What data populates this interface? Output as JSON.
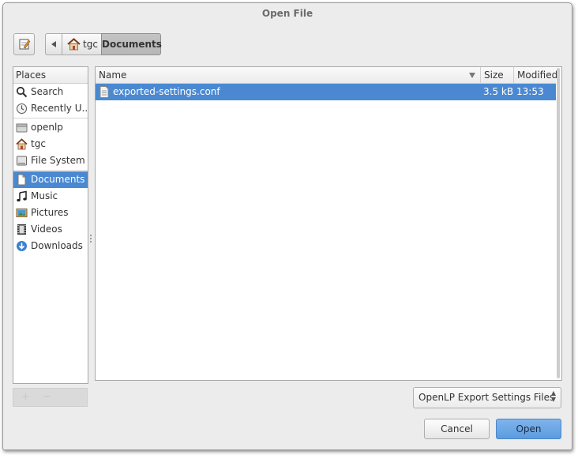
{
  "window": {
    "title": "Open File"
  },
  "toolbar": {
    "edit_icon": "text-edit-icon",
    "back_icon": "left-arrow-icon",
    "breadcrumbs": [
      {
        "label": "tgc",
        "icon": "home-icon"
      },
      {
        "label": "Documents"
      }
    ]
  },
  "places": {
    "header": "Places",
    "items": [
      {
        "label": "Search",
        "icon": "search-icon"
      },
      {
        "label": "Recently U...",
        "icon": "recent-icon"
      },
      {
        "label": "openlp",
        "icon": "drive-icon"
      },
      {
        "label": "tgc",
        "icon": "home-icon"
      },
      {
        "label": "File System",
        "icon": "harddisk-icon"
      },
      {
        "label": "Documents",
        "icon": "document-icon",
        "selected": true
      },
      {
        "label": "Music",
        "icon": "music-icon"
      },
      {
        "label": "Pictures",
        "icon": "pictures-icon"
      },
      {
        "label": "Videos",
        "icon": "video-icon"
      },
      {
        "label": "Downloads",
        "icon": "download-icon"
      }
    ],
    "add_label": "+",
    "remove_label": "−"
  },
  "files": {
    "columns": {
      "name": "Name",
      "size": "Size",
      "modified": "Modified"
    },
    "rows": [
      {
        "name": "exported-settings.conf",
        "size": "3.5 kB",
        "modified": "13:53",
        "selected": true
      }
    ]
  },
  "filter": {
    "selected": "OpenLP Export Settings Files"
  },
  "buttons": {
    "cancel": "Cancel",
    "open": "Open"
  },
  "colors": {
    "selection": "#4a89d1",
    "open_button": "#6aa6e6"
  }
}
